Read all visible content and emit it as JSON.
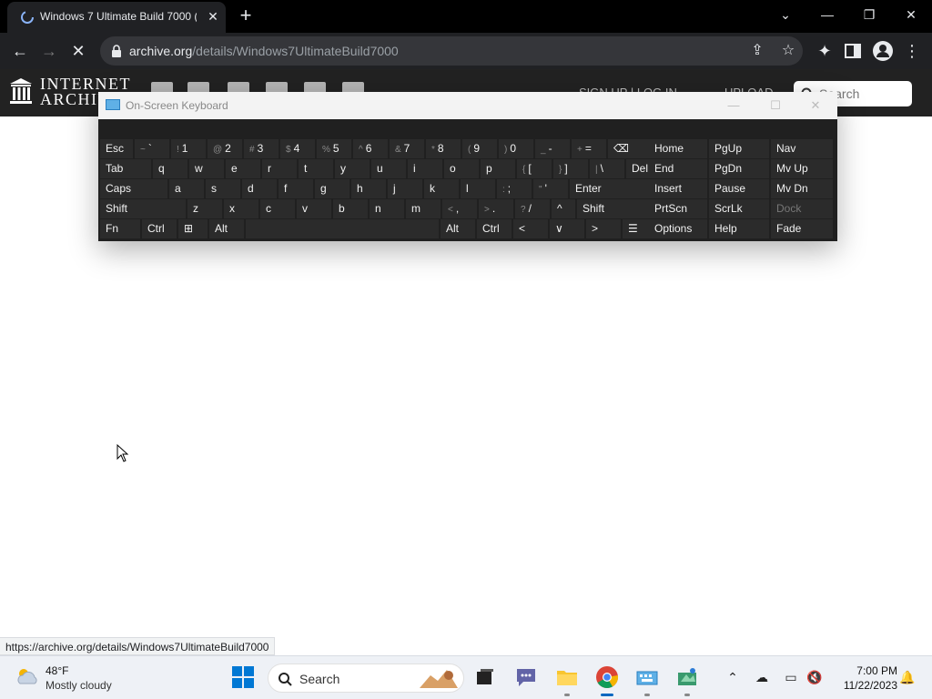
{
  "browser": {
    "tab_title": "Windows 7 Ultimate Build 7000 (",
    "tab_close": "✕",
    "new_tab": "+",
    "url_host": "archive.org",
    "url_path": "/details/Windows7UltimateBuild7000",
    "status_url": "https://archive.org/details/Windows7UltimateBuild7000",
    "window_controls": {
      "dropdown": "⌄",
      "minimize": "—",
      "restore": "❐",
      "close": "✕"
    }
  },
  "archive_header": {
    "logo_line1": "INTERNET",
    "logo_line2": "ARCHIVE",
    "signin": "SIGN UP | LOG IN",
    "upload": "UPLOAD",
    "search_placeholder": "Search"
  },
  "osk": {
    "title": "On-Screen Keyboard",
    "rows": [
      [
        {
          "label": "Esc"
        },
        {
          "sub": "~",
          "label": "`"
        },
        {
          "sub": "!",
          "label": "1"
        },
        {
          "sub": "@",
          "label": "2"
        },
        {
          "sub": "#",
          "label": "3"
        },
        {
          "sub": "$",
          "label": "4"
        },
        {
          "sub": "%",
          "label": "5"
        },
        {
          "sub": "^",
          "label": "6"
        },
        {
          "sub": "&",
          "label": "7"
        },
        {
          "sub": "*",
          "label": "8"
        },
        {
          "sub": "(",
          "label": "9"
        },
        {
          "sub": ")",
          "label": "0"
        },
        {
          "sub": "_",
          "label": "-"
        },
        {
          "sub": "+",
          "label": "="
        },
        {
          "label": "⌫"
        },
        {
          "label": "Home"
        },
        {
          "label": "PgUp"
        },
        {
          "label": "Nav"
        }
      ],
      [
        {
          "label": "Tab"
        },
        {
          "label": "q"
        },
        {
          "label": "w"
        },
        {
          "label": "e"
        },
        {
          "label": "r"
        },
        {
          "label": "t"
        },
        {
          "label": "y"
        },
        {
          "label": "u"
        },
        {
          "label": "i"
        },
        {
          "label": "o"
        },
        {
          "label": "p"
        },
        {
          "sub": "{",
          "label": "["
        },
        {
          "sub": "}",
          "label": "]"
        },
        {
          "sub": "|",
          "label": "\\"
        },
        {
          "label": "Del"
        },
        {
          "label": "End"
        },
        {
          "label": "PgDn"
        },
        {
          "label": "Mv Up"
        }
      ],
      [
        {
          "label": "Caps"
        },
        {
          "label": "a"
        },
        {
          "label": "s"
        },
        {
          "label": "d"
        },
        {
          "label": "f"
        },
        {
          "label": "g"
        },
        {
          "label": "h"
        },
        {
          "label": "j"
        },
        {
          "label": "k"
        },
        {
          "label": "l"
        },
        {
          "sub": ":",
          "label": ";"
        },
        {
          "sub": "\"",
          "label": "'"
        },
        {
          "label": "Enter"
        },
        {
          "label": "Insert"
        },
        {
          "label": "Pause"
        },
        {
          "label": "Mv Dn"
        }
      ],
      [
        {
          "label": "Shift"
        },
        {
          "label": "z"
        },
        {
          "label": "x"
        },
        {
          "label": "c"
        },
        {
          "label": "v"
        },
        {
          "label": "b"
        },
        {
          "label": "n"
        },
        {
          "label": "m"
        },
        {
          "sub": "<",
          "label": ","
        },
        {
          "sub": ">",
          "label": "."
        },
        {
          "sub": "?",
          "label": "/"
        },
        {
          "label": "^"
        },
        {
          "label": "Shift"
        },
        {
          "label": "PrtScn"
        },
        {
          "label": "ScrLk"
        },
        {
          "label": "Dock"
        }
      ],
      [
        {
          "label": "Fn"
        },
        {
          "label": "Ctrl"
        },
        {
          "label": "⊞"
        },
        {
          "label": "Alt"
        },
        {
          "label": ""
        },
        {
          "label": "Alt"
        },
        {
          "label": "Ctrl"
        },
        {
          "label": "<"
        },
        {
          "label": "∨"
        },
        {
          "label": ">"
        },
        {
          "label": "☰"
        },
        {
          "label": "Options"
        },
        {
          "label": "Help"
        },
        {
          "label": "Fade"
        }
      ]
    ]
  },
  "taskbar": {
    "weather_temp": "48°F",
    "weather_condition": "Mostly cloudy",
    "search_label": "Search",
    "time": "7:00 PM",
    "date": "11/22/2023"
  },
  "colors": {
    "chrome_bg": "#202124",
    "osk_key": "#2b2b2b",
    "taskbar_bg": "#eef1f6",
    "accent": "#0067c0"
  }
}
